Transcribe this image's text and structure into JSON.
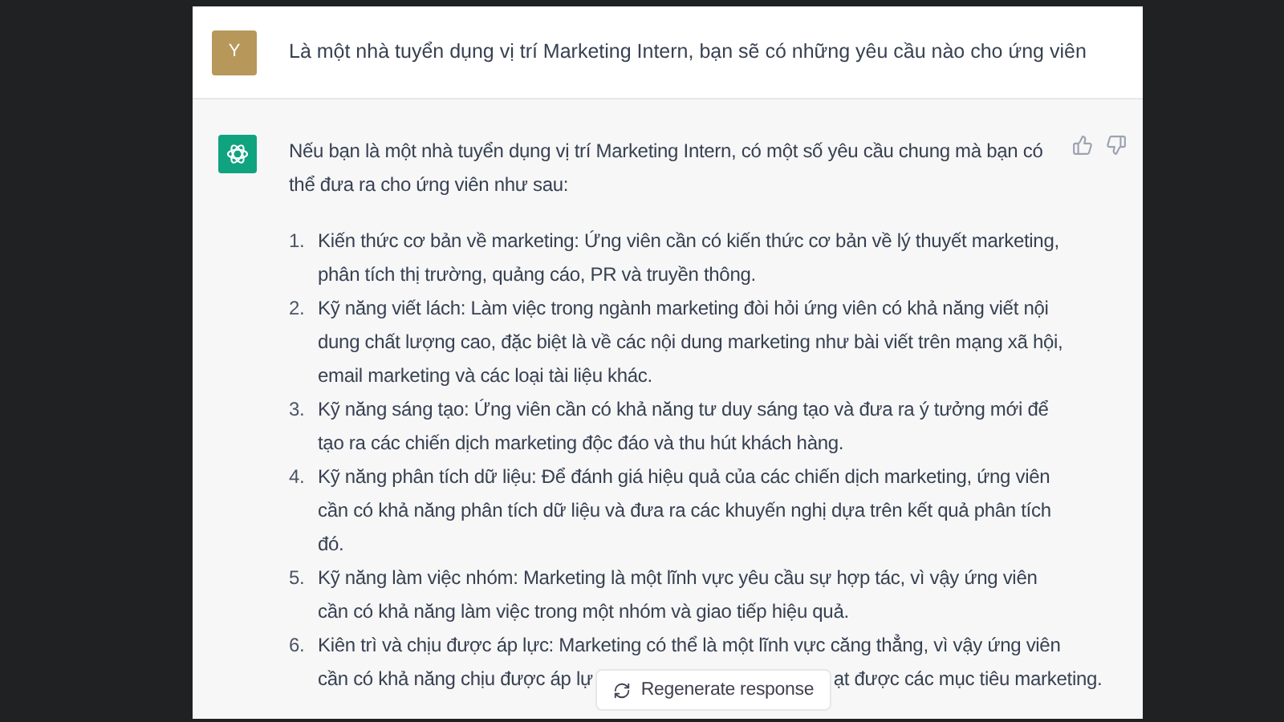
{
  "user_message": {
    "avatar_letter": "Y",
    "text": "Là một nhà tuyển dụng vị trí Marketing Intern, bạn sẽ có những yêu cầu nào cho ứng viên"
  },
  "assistant_message": {
    "intro": "Nếu bạn là một nhà tuyển dụng vị trí Marketing Intern, có một số yêu cầu chung mà bạn có thể đưa ra cho ứng viên như sau:",
    "items": [
      {
        "number": "1.",
        "text": "Kiến thức cơ bản về marketing: Ứng viên cần có kiến thức cơ bản về lý thuyết marketing, phân tích thị trường, quảng cáo, PR và truyền thông."
      },
      {
        "number": "2.",
        "text": "Kỹ năng viết lách: Làm việc trong ngành marketing đòi hỏi ứng viên có khả năng viết nội dung chất lượng cao, đặc biệt là về các nội dung marketing như bài viết trên mạng xã hội, email marketing và các loại tài liệu khác."
      },
      {
        "number": "3.",
        "text": "Kỹ năng sáng tạo: Ứng viên cần có khả năng tư duy sáng tạo và đưa ra ý tưởng mới để tạo ra các chiến dịch marketing độc đáo và thu hút khách hàng."
      },
      {
        "number": "4.",
        "text": "Kỹ năng phân tích dữ liệu: Để đánh giá hiệu quả của các chiến dịch marketing, ứng viên cần có khả năng phân tích dữ liệu và đưa ra các khuyến nghị dựa trên kết quả phân tích đó."
      },
      {
        "number": "5.",
        "text": "Kỹ năng làm việc nhóm: Marketing là một lĩnh vực yêu cầu sự hợp tác, vì vậy ứng viên cần có khả năng làm việc trong một nhóm và giao tiếp hiệu quả."
      },
      {
        "number": "6.",
        "text": "Kiên trì và chịu được áp lực: Marketing có thể là một lĩnh vực căng thẳng, vì vậy ứng viên",
        "covered_line": [
          "cần có khả năng chịu được áp lự",
          "ạt được các mục tiêu marketing."
        ]
      }
    ]
  },
  "regenerate_button": {
    "label": "Regenerate response"
  }
}
